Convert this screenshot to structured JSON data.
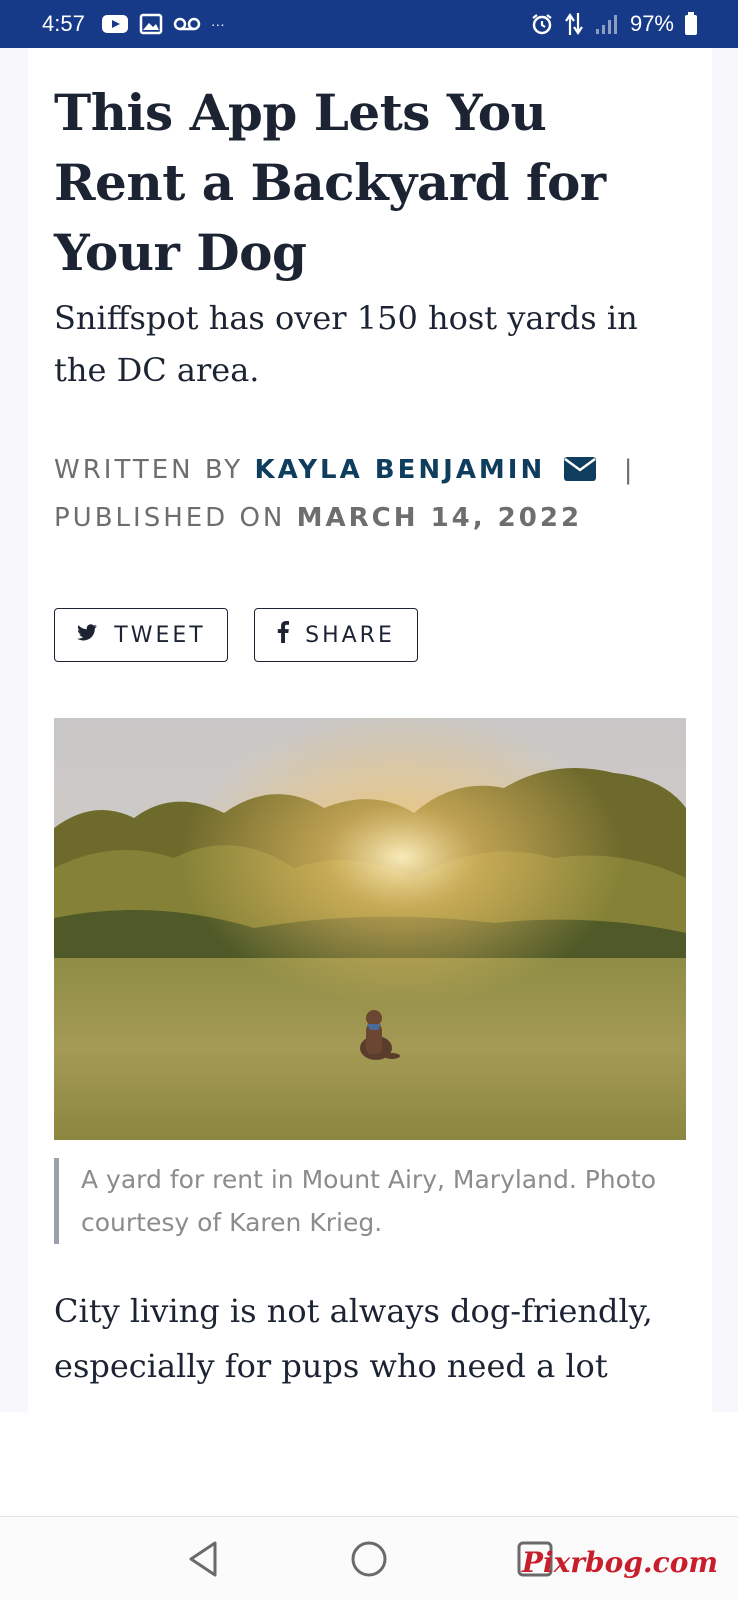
{
  "status_bar": {
    "time": "4:57",
    "battery": "97%",
    "left_icons": [
      "youtube-icon",
      "gallery-icon",
      "voicemail-icon",
      "more-dots-icon"
    ],
    "right_icons": [
      "alarm-icon",
      "data-transfer-icon",
      "signal-icon",
      "battery-icon"
    ],
    "dots": "···"
  },
  "article": {
    "headline": "This App Lets You Rent a Backyard for Your Dog",
    "dek": "Sniffspot has over 150 host yards in the DC area.",
    "byline": {
      "written_by_label": "WRITTEN BY",
      "author": "KAYLA BENJAMIN",
      "separator": "|",
      "published_on_label": "PUBLISHED ON",
      "date": "MARCH 14, 2022"
    },
    "share": {
      "tweet_label": "TWEET",
      "share_label": "SHARE"
    },
    "image_caption": "A yard for rent in Mount Airy, Maryland. Photo courtesy of Karen Krieg.",
    "body_preview": "City living is not always dog-friendly, especially for pups who need a lot more"
  },
  "watermark": "Pixrbog.com",
  "colors": {
    "status_bar": "#163a87",
    "headline": "#1c2433",
    "author": "#0e3d5e",
    "meta_gray": "#6e6e6e",
    "caption_gray": "#8c8c8c"
  }
}
